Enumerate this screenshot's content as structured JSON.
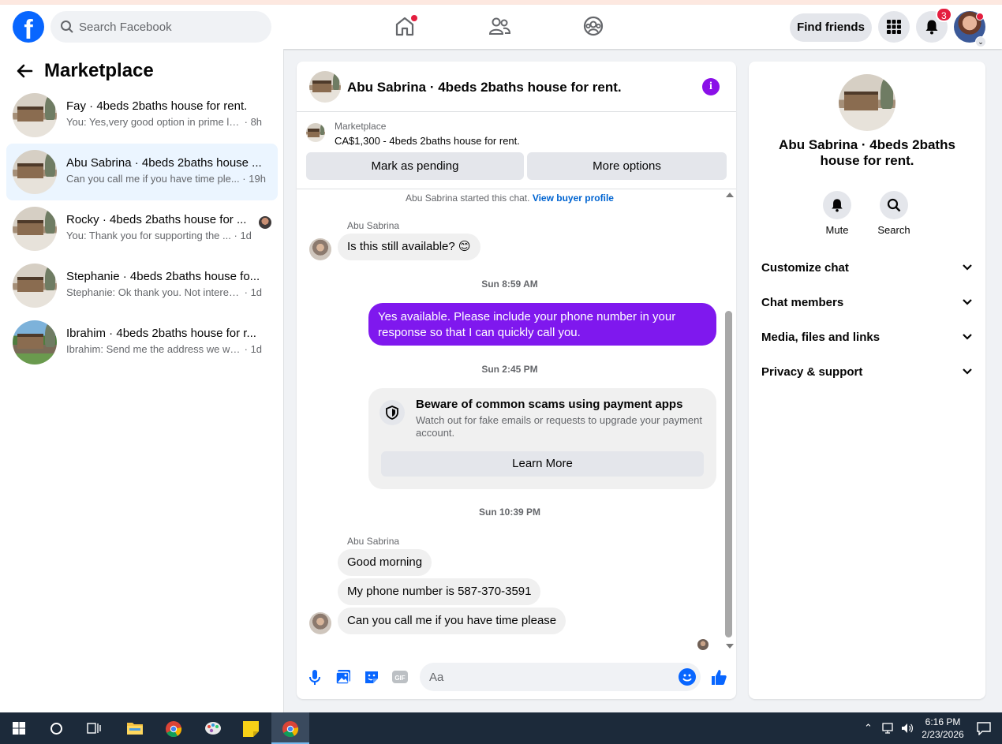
{
  "topnav": {
    "logo": "f",
    "search_placeholder": "Search Facebook",
    "find_friends": "Find friends",
    "notification_count": "3"
  },
  "left": {
    "title": "Marketplace",
    "conversations": [
      {
        "title": "Fay · 4beds 2baths house for rent.",
        "snippet": "You: Yes,very good option in prime lo...",
        "time": "· 8h",
        "active": false
      },
      {
        "title": "Abu Sabrina · 4beds 2baths house ...",
        "snippet": "Can you call me if you have time ple...",
        "time": "· 19h",
        "active": true
      },
      {
        "title": "Rocky · 4beds 2baths house for ...",
        "snippet": "You: Thank you for supporting the ...",
        "time": "· 1d",
        "active": false
      },
      {
        "title": "Stephanie · 4beds 2baths house fo...",
        "snippet": "Stephanie: Ok thank you. Not interest...",
        "time": "· 1d",
        "active": false
      },
      {
        "title": "Ibrahim · 4beds 2baths house for r...",
        "snippet": "Ibrahim: Send me the address we will ...",
        "time": "· 1d",
        "active": false
      }
    ]
  },
  "chat": {
    "title": "Abu Sabrina · 4beds 2baths house for rent.",
    "marketplace_label": "Marketplace",
    "listing": "CA$1,300 - 4beds 2baths house for rent.",
    "btn_pending": "Mark as pending",
    "btn_more": "More options",
    "started_text": "Abu Sabrina started this chat.",
    "view_buyer": "View buyer profile",
    "sender_name": "Abu Sabrina",
    "msg_available": "Is this still available? 😊",
    "ts1": "Sun 8:59 AM",
    "msg_reply": "Yes available. Please include your phone number in your response so that I can quickly call you.",
    "ts2": "Sun 2:45 PM",
    "scam_title": "Beware of common scams using payment apps",
    "scam_body": "Watch out for fake emails or requests to upgrade your payment account.",
    "learn_more": "Learn More",
    "ts3": "Sun 10:39 PM",
    "msg_morning": "Good morning",
    "msg_phone": "My phone number is 587-370-3591",
    "msg_call": "Can you call me if you have time please",
    "input_placeholder": "Aa"
  },
  "right": {
    "title": "Abu Sabrina · 4beds 2baths house for rent.",
    "mute": "Mute",
    "search": "Search",
    "sections": [
      "Customize chat",
      "Chat members",
      "Media, files and links",
      "Privacy & support"
    ]
  },
  "taskbar": {
    "time": "6:16 PM",
    "date": "2/23/2026"
  },
  "colors": {
    "accent": "#0866ff",
    "outgoing_bubble": "#7f18ee",
    "active_conversation": "#ebf5ff"
  }
}
